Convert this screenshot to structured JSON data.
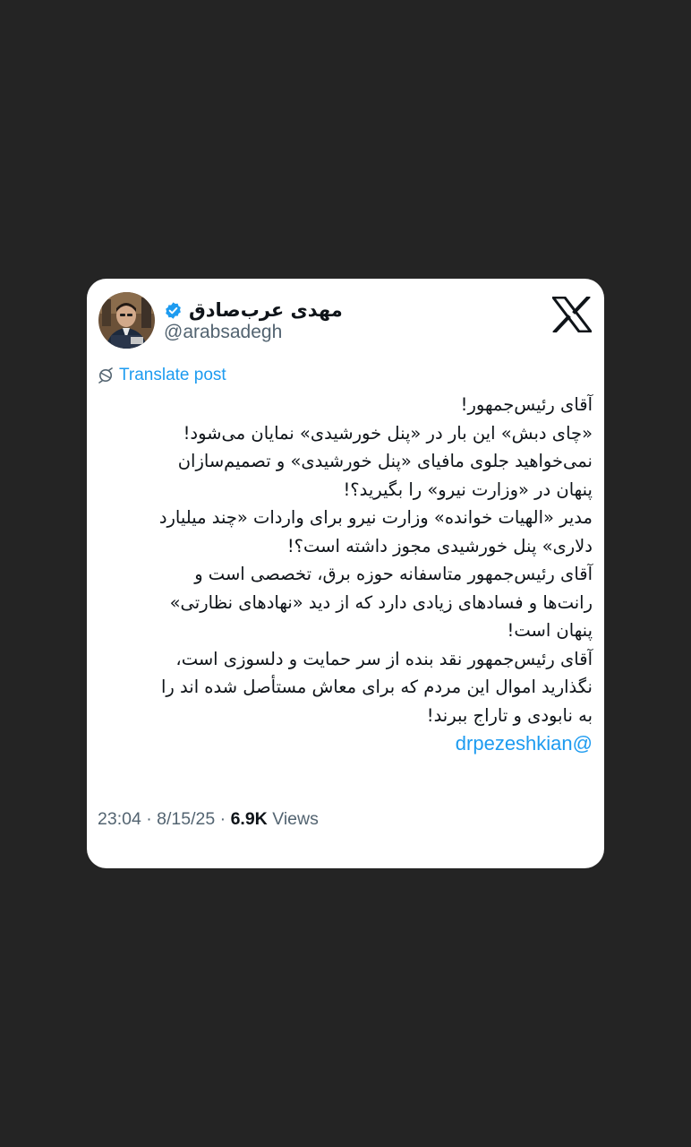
{
  "author": {
    "display_name": "مهدی عرب‌صادق",
    "handle": "@arabsadegh",
    "verified": true
  },
  "brand": {
    "logo": "x-logo",
    "accent_color": "#1d9bf0"
  },
  "translate": {
    "label": "Translate post",
    "icon": "translate-icon"
  },
  "tweet": {
    "lines": [
      "آقای رئیس‌جمهور!",
      "«چای دبش» این بار در «پنل خورشیدی» نمایان می‌شود!",
      "نمی‌خواهید جلوی مافیای «پنل خورشیدی» و تصمیم‌سازان",
      "پنهان در «وزارت نیرو» را بگیرید؟!",
      "مدیر «الهیات خوانده» وزارت نیرو برای واردات «چند میلیارد",
      "دلاری» پنل خورشیدی مجوز داشته است؟!",
      "آقای رئیس‌جمهور متاسفانه حوزه برق، تخصصی است و",
      "رانت‌ها و فسادهای زیادی دارد که از دید «نهادهای نظارتی»",
      "پنهان است!",
      "آقای رئیس‌جمهور نقد بنده از سر حمایت و دلسوزی است،",
      "نگذارید اموال این مردم که برای معاش مستأصل شده اند را",
      "به نابودی و تاراج ببرند!"
    ],
    "mention": "@drpezeshkian"
  },
  "meta": {
    "time": "23:04",
    "separator": "·",
    "date": "8/15/25",
    "views_count": "6.9K",
    "views_label": "Views"
  }
}
